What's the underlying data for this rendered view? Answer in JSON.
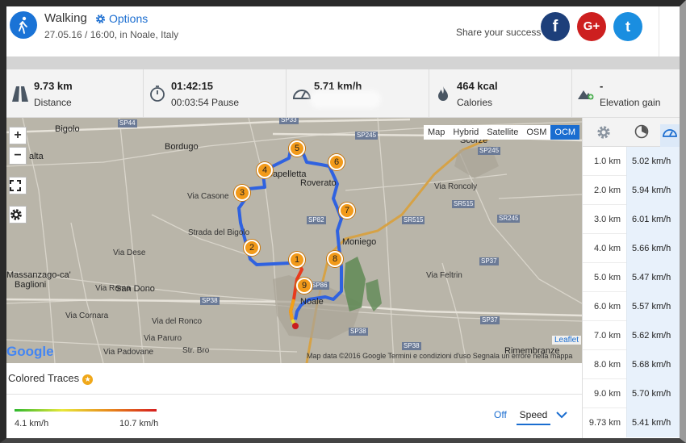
{
  "header": {
    "activity": "Walking",
    "options_label": "Options",
    "subtitle": "27.05.16 / 16:00, in Noale, Italy",
    "share_text": "Share your success",
    "social": [
      {
        "icon": "facebook-icon",
        "label": "f"
      },
      {
        "icon": "google-plus-icon",
        "label": "G+"
      },
      {
        "icon": "twitter-icon",
        "label": "t"
      }
    ]
  },
  "stats": [
    {
      "icon": "road-icon",
      "value": "9.73 km",
      "label": "Distance"
    },
    {
      "icon": "stopwatch-icon",
      "value": "01:42:15",
      "label": "00:03:54 Pause"
    },
    {
      "icon": "speedometer-icon",
      "value": "5.71 km/h",
      "label": ""
    },
    {
      "icon": "flame-icon",
      "value": "464 kcal",
      "label": "Calories"
    },
    {
      "icon": "mountain-icon",
      "value": "-",
      "label": "Elevation gain"
    }
  ],
  "map": {
    "controls": {
      "zoom_in": "+",
      "zoom_out": "−"
    },
    "map_types": [
      "Map",
      "Hybrid",
      "Satellite",
      "OSM",
      "OCM"
    ],
    "active_map_type": "OCM",
    "attribution_logo": "Google",
    "leaflet": "Leaflet",
    "copyright": "Map data ©2016 Google    Termini e condizioni d'uso    Segnala un errore nella mappa",
    "places": [
      {
        "name": "Bigolo"
      },
      {
        "name": "Bordugo"
      },
      {
        "name": "alta"
      },
      {
        "name": "Capelletta"
      },
      {
        "name": "Roverato"
      },
      {
        "name": "Via Casone"
      },
      {
        "name": "Strada del Bigolo"
      },
      {
        "name": "Moniego"
      },
      {
        "name": "Massanzago-ca'"
      },
      {
        "name": "Baglioni"
      },
      {
        "name": "Via Roma"
      },
      {
        "name": "San Dono"
      },
      {
        "name": "Noale"
      },
      {
        "name": "Scorzè"
      },
      {
        "name": "Via Roncoly"
      },
      {
        "name": "Via Feltrin"
      },
      {
        "name": "Rimembranze"
      },
      {
        "name": "Via del Ronco"
      },
      {
        "name": "Via Padovane"
      },
      {
        "name": "Via Dese"
      },
      {
        "name": "Via Cornara"
      },
      {
        "name": "Via Paruro"
      },
      {
        "name": "Str. Bro"
      }
    ],
    "roads": [
      "SP44",
      "SP33",
      "SP245",
      "SP82",
      "SR515",
      "SR245",
      "SP37",
      "SP38",
      "SP38",
      "SP38",
      "SP37",
      "SP86",
      "SP245",
      "SR515"
    ],
    "pins": [
      "1",
      "2",
      "3",
      "4",
      "5",
      "6",
      "7",
      "8",
      "9"
    ]
  },
  "colored_traces": {
    "title": "Colored Traces",
    "min": "4.1 km/h",
    "max": "10.7 km/h",
    "off_label": "Off",
    "mode_label": "Speed",
    "gradient_colors": [
      "#2eb82e",
      "#e8e83a",
      "#e8891c",
      "#d51d1d"
    ]
  },
  "splits": [
    {
      "distance": "1.0 km",
      "speed": "5.02 km/h"
    },
    {
      "distance": "2.0 km",
      "speed": "5.94 km/h"
    },
    {
      "distance": "3.0 km",
      "speed": "6.01 km/h"
    },
    {
      "distance": "4.0 km",
      "speed": "5.66 km/h"
    },
    {
      "distance": "5.0 km",
      "speed": "5.47 km/h"
    },
    {
      "distance": "6.0 km",
      "speed": "5.57 km/h"
    },
    {
      "distance": "7.0 km",
      "speed": "5.62 km/h"
    },
    {
      "distance": "8.0 km",
      "speed": "5.68 km/h"
    },
    {
      "distance": "9.0 km",
      "speed": "5.70 km/h"
    },
    {
      "distance": "9.73 km",
      "speed": "5.41 km/h"
    }
  ],
  "colors": {
    "accent": "#1a6dd0",
    "route": "#2f62e0",
    "pin": "#f29a1a"
  }
}
